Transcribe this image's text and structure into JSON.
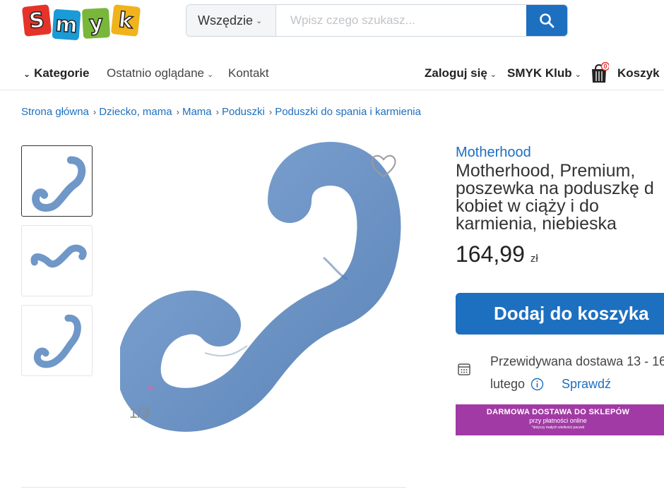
{
  "logo": {
    "letters": [
      "S",
      "m",
      "y",
      "k"
    ],
    "colors": [
      "#e5332a",
      "#1a9ad6",
      "#79b73a",
      "#f1b31c"
    ]
  },
  "search": {
    "scope": "Wszędzie",
    "placeholder": "Wpisz czego szukasz..."
  },
  "nav": {
    "categories": "Kategorie",
    "recent": "Ostatnio oglądane",
    "contact": "Kontakt",
    "login": "Zaloguj się",
    "club": "SMYK Klub",
    "cart_label": "Koszyk",
    "cart_count": "0"
  },
  "breadcrumb": [
    "Strona główna",
    "Dziecko, mama",
    "Mama",
    "Poduszki",
    "Poduszki do spania i karmienia"
  ],
  "gallery": {
    "counter": "1/3"
  },
  "product": {
    "brand": "Motherhood",
    "title_lines": [
      "Motherhood, Premium,",
      "poszewka na poduszkę d",
      "kobiet w ciąży i do",
      "karmienia, niebieska"
    ],
    "price": "164,99",
    "currency": "zł",
    "add_to_cart": "Dodaj do koszyka",
    "delivery_line1": "Przewidywana dostawa 13 - 16",
    "delivery_line2": "lutego",
    "check_link": "Sprawdź"
  },
  "promo": {
    "line1": "DARMOWA DOSTAWA DO SKLEPÓW",
    "line2": "przy płatności online",
    "line3": "*dotyczy małych wielkości paczek"
  },
  "colors": {
    "accent": "#1d6fc0",
    "pillow": "#6f97c8",
    "promo": "#a23aa5"
  }
}
